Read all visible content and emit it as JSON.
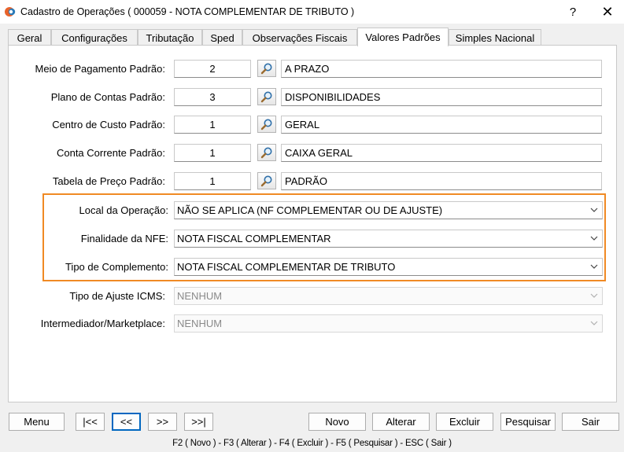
{
  "window": {
    "title": "Cadastro de Operações ( 000059 - NOTA COMPLEMENTAR DE TRIBUTO )",
    "help_label": "?",
    "close_label": "✕"
  },
  "tabs": [
    {
      "label": "Geral"
    },
    {
      "label": "Configurações"
    },
    {
      "label": "Tributação"
    },
    {
      "label": "Sped"
    },
    {
      "label": "Observações Fiscais"
    },
    {
      "label": "Valores Padrões"
    },
    {
      "label": "Simples Nacional"
    }
  ],
  "active_tab": "Valores Padrões",
  "lookup_fields": [
    {
      "label": "Meio de Pagamento Padrão:",
      "code": "2",
      "description": "A PRAZO"
    },
    {
      "label": "Plano de Contas Padrão:",
      "code": "3",
      "description": "DISPONIBILIDADES"
    },
    {
      "label": "Centro de Custo Padrão:",
      "code": "1",
      "description": "GERAL"
    },
    {
      "label": "Conta Corrente Padrão:",
      "code": "1",
      "description": "CAIXA GERAL"
    },
    {
      "label": "Tabela de Preço Padrão:",
      "code": "1",
      "description": "PADRÃO"
    }
  ],
  "combo_fields": [
    {
      "label": "Local da Operação:",
      "value": "NÃO SE APLICA (NF COMPLEMENTAR OU DE AJUSTE)",
      "enabled": true
    },
    {
      "label": "Finalidade da NFE:",
      "value": "NOTA FISCAL COMPLEMENTAR",
      "enabled": true
    },
    {
      "label": "Tipo de Complemento:",
      "value": "NOTA FISCAL COMPLEMENTAR DE TRIBUTO",
      "enabled": true
    },
    {
      "label": "Tipo de Ajuste ICMS:",
      "value": "NENHUM",
      "enabled": false
    },
    {
      "label": "Intermediador/Marketplace:",
      "value": "NENHUM",
      "enabled": false
    }
  ],
  "highlight_color": "#f08a24",
  "buttons": {
    "menu": "Menu",
    "first": "|<<",
    "prev": "<<",
    "next": ">>",
    "last": ">>|",
    "novo": "Novo",
    "alterar": "Alterar",
    "excluir": "Excluir",
    "pesquisar": "Pesquisar",
    "sair": "Sair"
  },
  "status_bar": "F2 ( Novo ) - F3 ( Alterar ) - F4 ( Excluir ) - F5 ( Pesquisar ) - ESC ( Sair )"
}
